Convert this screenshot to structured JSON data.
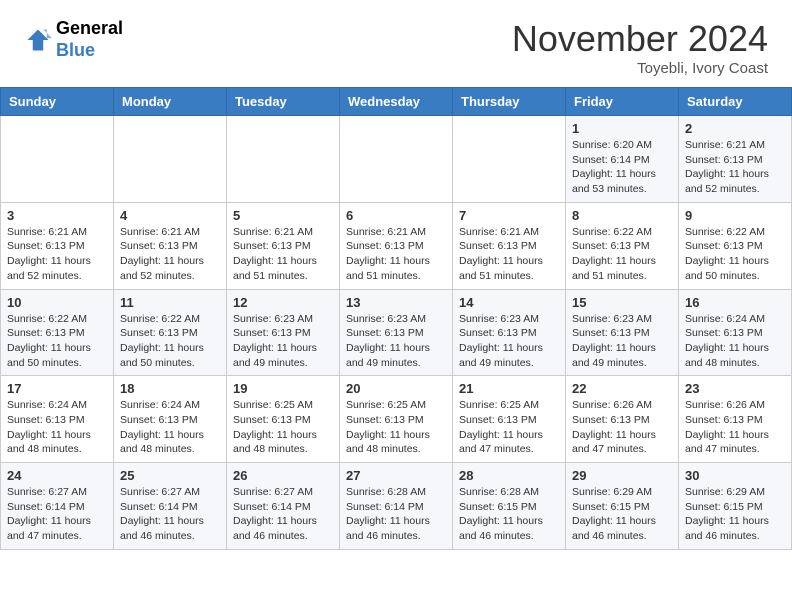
{
  "header": {
    "logo_general": "General",
    "logo_blue": "Blue",
    "month": "November 2024",
    "location": "Toyebli, Ivory Coast"
  },
  "weekdays": [
    "Sunday",
    "Monday",
    "Tuesday",
    "Wednesday",
    "Thursday",
    "Friday",
    "Saturday"
  ],
  "weeks": [
    [
      {
        "day": "",
        "detail": ""
      },
      {
        "day": "",
        "detail": ""
      },
      {
        "day": "",
        "detail": ""
      },
      {
        "day": "",
        "detail": ""
      },
      {
        "day": "",
        "detail": ""
      },
      {
        "day": "1",
        "detail": "Sunrise: 6:20 AM\nSunset: 6:14 PM\nDaylight: 11 hours\nand 53 minutes."
      },
      {
        "day": "2",
        "detail": "Sunrise: 6:21 AM\nSunset: 6:13 PM\nDaylight: 11 hours\nand 52 minutes."
      }
    ],
    [
      {
        "day": "3",
        "detail": "Sunrise: 6:21 AM\nSunset: 6:13 PM\nDaylight: 11 hours\nand 52 minutes."
      },
      {
        "day": "4",
        "detail": "Sunrise: 6:21 AM\nSunset: 6:13 PM\nDaylight: 11 hours\nand 52 minutes."
      },
      {
        "day": "5",
        "detail": "Sunrise: 6:21 AM\nSunset: 6:13 PM\nDaylight: 11 hours\nand 51 minutes."
      },
      {
        "day": "6",
        "detail": "Sunrise: 6:21 AM\nSunset: 6:13 PM\nDaylight: 11 hours\nand 51 minutes."
      },
      {
        "day": "7",
        "detail": "Sunrise: 6:21 AM\nSunset: 6:13 PM\nDaylight: 11 hours\nand 51 minutes."
      },
      {
        "day": "8",
        "detail": "Sunrise: 6:22 AM\nSunset: 6:13 PM\nDaylight: 11 hours\nand 51 minutes."
      },
      {
        "day": "9",
        "detail": "Sunrise: 6:22 AM\nSunset: 6:13 PM\nDaylight: 11 hours\nand 50 minutes."
      }
    ],
    [
      {
        "day": "10",
        "detail": "Sunrise: 6:22 AM\nSunset: 6:13 PM\nDaylight: 11 hours\nand 50 minutes."
      },
      {
        "day": "11",
        "detail": "Sunrise: 6:22 AM\nSunset: 6:13 PM\nDaylight: 11 hours\nand 50 minutes."
      },
      {
        "day": "12",
        "detail": "Sunrise: 6:23 AM\nSunset: 6:13 PM\nDaylight: 11 hours\nand 49 minutes."
      },
      {
        "day": "13",
        "detail": "Sunrise: 6:23 AM\nSunset: 6:13 PM\nDaylight: 11 hours\nand 49 minutes."
      },
      {
        "day": "14",
        "detail": "Sunrise: 6:23 AM\nSunset: 6:13 PM\nDaylight: 11 hours\nand 49 minutes."
      },
      {
        "day": "15",
        "detail": "Sunrise: 6:23 AM\nSunset: 6:13 PM\nDaylight: 11 hours\nand 49 minutes."
      },
      {
        "day": "16",
        "detail": "Sunrise: 6:24 AM\nSunset: 6:13 PM\nDaylight: 11 hours\nand 48 minutes."
      }
    ],
    [
      {
        "day": "17",
        "detail": "Sunrise: 6:24 AM\nSunset: 6:13 PM\nDaylight: 11 hours\nand 48 minutes."
      },
      {
        "day": "18",
        "detail": "Sunrise: 6:24 AM\nSunset: 6:13 PM\nDaylight: 11 hours\nand 48 minutes."
      },
      {
        "day": "19",
        "detail": "Sunrise: 6:25 AM\nSunset: 6:13 PM\nDaylight: 11 hours\nand 48 minutes."
      },
      {
        "day": "20",
        "detail": "Sunrise: 6:25 AM\nSunset: 6:13 PM\nDaylight: 11 hours\nand 48 minutes."
      },
      {
        "day": "21",
        "detail": "Sunrise: 6:25 AM\nSunset: 6:13 PM\nDaylight: 11 hours\nand 47 minutes."
      },
      {
        "day": "22",
        "detail": "Sunrise: 6:26 AM\nSunset: 6:13 PM\nDaylight: 11 hours\nand 47 minutes."
      },
      {
        "day": "23",
        "detail": "Sunrise: 6:26 AM\nSunset: 6:13 PM\nDaylight: 11 hours\nand 47 minutes."
      }
    ],
    [
      {
        "day": "24",
        "detail": "Sunrise: 6:27 AM\nSunset: 6:14 PM\nDaylight: 11 hours\nand 47 minutes."
      },
      {
        "day": "25",
        "detail": "Sunrise: 6:27 AM\nSunset: 6:14 PM\nDaylight: 11 hours\nand 46 minutes."
      },
      {
        "day": "26",
        "detail": "Sunrise: 6:27 AM\nSunset: 6:14 PM\nDaylight: 11 hours\nand 46 minutes."
      },
      {
        "day": "27",
        "detail": "Sunrise: 6:28 AM\nSunset: 6:14 PM\nDaylight: 11 hours\nand 46 minutes."
      },
      {
        "day": "28",
        "detail": "Sunrise: 6:28 AM\nSunset: 6:15 PM\nDaylight: 11 hours\nand 46 minutes."
      },
      {
        "day": "29",
        "detail": "Sunrise: 6:29 AM\nSunset: 6:15 PM\nDaylight: 11 hours\nand 46 minutes."
      },
      {
        "day": "30",
        "detail": "Sunrise: 6:29 AM\nSunset: 6:15 PM\nDaylight: 11 hours\nand 46 minutes."
      }
    ]
  ]
}
